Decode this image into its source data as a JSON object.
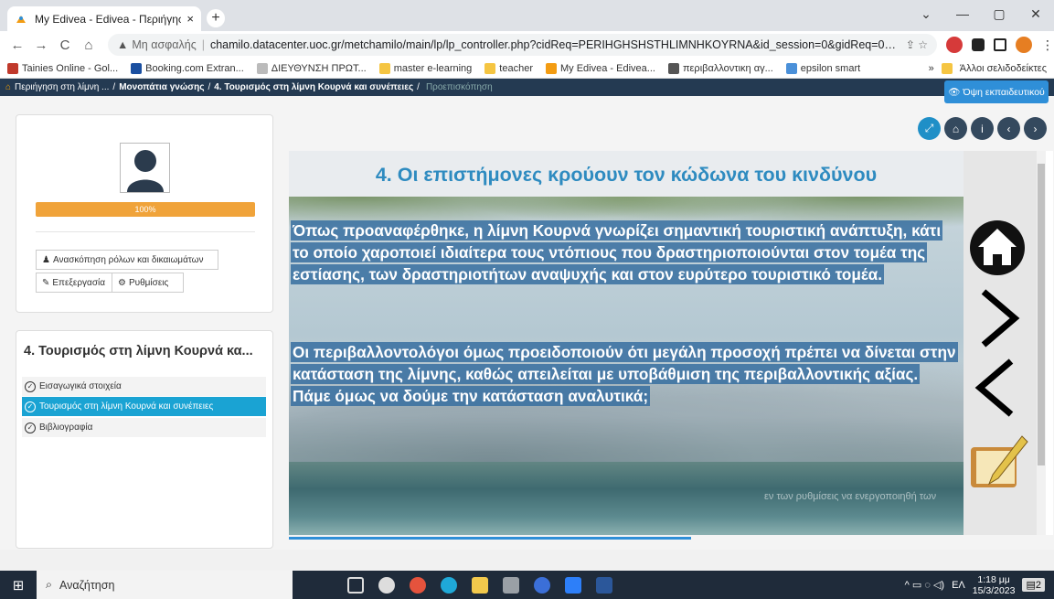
{
  "browser": {
    "tab_title": "My Edivea - Edivea - Περιήγηση",
    "tab_close": "×",
    "new_tab": "+",
    "window_controls": [
      "⌄",
      "—",
      "▢",
      "✕"
    ],
    "nav": {
      "back": "←",
      "forward": "→",
      "reload": "C",
      "home": "⌂"
    },
    "security_label": "Μη ασφαλής",
    "url": "chamilo.datacenter.uoc.gr/metchamilo/main/lp/lp_controller.php?cidReq=PERIHGHSHSTHLIMNHKOYRNA&id_session=0&gidReq=0&gr...",
    "bookmarks": [
      {
        "label": "Tainies Online - Gol...",
        "color": "#c0392b"
      },
      {
        "label": "Booking.com Extran...",
        "color": "#1a4fa0"
      },
      {
        "label": "ΔΙΕΥΘΥΝΣΗ ΠΡΩΤ...",
        "color": "#bbbbbb"
      },
      {
        "label": "master e-learning",
        "color": "#f5c542"
      },
      {
        "label": "teacher",
        "color": "#f5c542"
      },
      {
        "label": "My Edivea - Edivea...",
        "color": "#f39c12"
      },
      {
        "label": "περιβαλλοντικη αγ...",
        "color": "#555555"
      },
      {
        "label": "epsilon smart",
        "color": "#4a90d9"
      }
    ],
    "bookmarks_more": "»",
    "bookmarks_other": "Άλλοι σελιδοδείκτες"
  },
  "breadcrumb": {
    "items": [
      "Περιήγηση στη λίμνη ...",
      "Μονοπάτια γνώσης",
      "4. Τουρισμός στη λίμνη Κουρνά και συνέπειες"
    ],
    "current": "Προεπισκόπηση",
    "teacher_view": "Όψη εκπαιδευτικού"
  },
  "sidebar": {
    "progress_label": "100%",
    "progress": 1.0,
    "buttons": {
      "roles": "Ανασκόπηση ρόλων και δικαιωμάτων",
      "edit": "Επεξεργασία",
      "settings": "Ρυθμίσεις"
    },
    "outline_title": "4. Τουρισμός στη λίμνη Κουρνά κα...",
    "items": [
      {
        "label": "Εισαγωγικά στοιχεία",
        "active": false
      },
      {
        "label": "Τουρισμός στη λίμνη Κουρνά και συνέπειες",
        "active": true
      },
      {
        "label": "Βιβλιογραφία",
        "active": false
      }
    ]
  },
  "slide": {
    "title": "4. Οι επιστήμονες κρούουν τον κώδωνα του κινδύνου",
    "paragraph1": "Όπως προαναφέρθηκε, η λίμνη Κουρνά γνωρίζει σημαντική τουριστική ανάπτυξη, κάτι το οποίο χαροποιεί ιδιαίτερα τους ντόπιους που δραστηριοποιούνται στον τομέα της εστίασης, των δραστηριοτήτων αναψυχής και στον ευρύτερο τουριστικό τομέα.",
    "paragraph2": "Οι περιβαλλοντολόγοι όμως προειδοποιούν ότι μεγάλη προσοχή πρέπει να δίνεται στην κατάσταση της λίμνης, καθώς απειλείται με υποβάθμιση της περιβαλλοντικής αξίας. Πάμε όμως να δούμε την κατάσταση αναλυτικά;",
    "faded_text": "εν των ρυθμίσεις να ενεργοποιηθή των"
  },
  "taskbar": {
    "search_placeholder": "Αναζήτηση",
    "lang": "ΕΛ",
    "time": "1:18 μμ",
    "date": "15/3/2023",
    "notifications": "2"
  }
}
